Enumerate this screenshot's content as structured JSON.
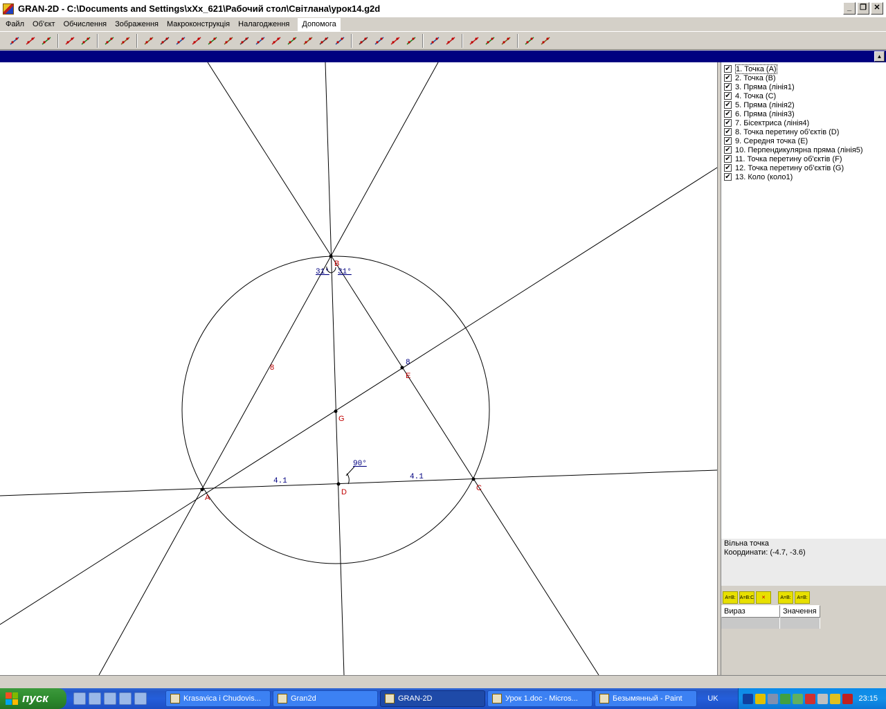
{
  "window": {
    "title": "GRAN-2D - C:\\Documents and Settings\\xXx_621\\Рабочий стол\\Світлана\\урок14.g2d",
    "buttons": {
      "minimize": "_",
      "maximize": "❐",
      "close": "✕"
    }
  },
  "menu": [
    "Файл",
    "Об'єкт",
    "Обчислення",
    "Зображення",
    "Макроконструкція",
    "Налагодження",
    "Допомога"
  ],
  "toolbar_groups": [
    [
      "new-file-icon",
      "open-folder-icon",
      "save-disk-icon"
    ],
    [
      "film-icon",
      "gears-icon"
    ],
    [
      "disabled-circle-icon",
      "scissors-icon"
    ],
    [
      "point-icon",
      "two-points-icon",
      "cross-lines-icon",
      "intersection-icon",
      "segment-icon",
      "parallel-icon",
      "perpendicular-icon",
      "angle-icon",
      "bisector-icon",
      "tangent-icon",
      "circle-icon",
      "arc-icon",
      "curve-icon"
    ],
    [
      "zoom-in-icon",
      "zoom-out-icon",
      "zoom-icon",
      "zoom-fit-icon"
    ],
    [
      "move-icon",
      "rotate-icon"
    ],
    [
      "calculator-icon",
      "measure-icon",
      "ruler-icon"
    ],
    [
      "macro-run-icon",
      "macro-edit-icon"
    ]
  ],
  "objects": [
    {
      "label": "1. Точка (A)",
      "checked": true,
      "selected": true
    },
    {
      "label": "2. Точка (B)",
      "checked": true
    },
    {
      "label": "3. Пряма (лінія1)",
      "checked": true
    },
    {
      "label": "4. Точка (C)",
      "checked": true
    },
    {
      "label": "5. Пряма (лінія2)",
      "checked": true
    },
    {
      "label": "6. Пряма (лінія3)",
      "checked": true
    },
    {
      "label": "7. Бісектриса (лінія4)",
      "checked": true
    },
    {
      "label": "8. Точка перетину об'єктів (D)",
      "checked": true
    },
    {
      "label": "9. Середня точка (E)",
      "checked": true
    },
    {
      "label": "10. Перпендикулярна пряма (лінія5)",
      "checked": true
    },
    {
      "label": "11. Точка перетину об'єктів (F)",
      "checked": true
    },
    {
      "label": "12. Точка перетину об'єктів (G)",
      "checked": true
    },
    {
      "label": "13. Коло (коло1)",
      "checked": true
    }
  ],
  "info": {
    "type": "Вільна точка",
    "coords": "Координати: (-4.7, -3.6)"
  },
  "expr_buttons": [
    "A=B:",
    "A=B:C",
    "✕",
    "A=B:",
    "A=B:"
  ],
  "expr_table": {
    "col1": "Вираз",
    "col2": "Значення"
  },
  "drawing": {
    "point_labels": {
      "A": "A",
      "B": "B",
      "C": "C",
      "D": "D",
      "E": "E",
      "G": "G"
    },
    "angle_left": "31°",
    "angle_right": "31°",
    "angle_right_deg": "°",
    "right_angle": "90°",
    "len_AD": "4.1",
    "len_DC": "4.1",
    "len_AB": "8",
    "len_BC": "8",
    "colors": {
      "label": "#c00000",
      "measure": "#000080",
      "line": "#000000"
    }
  },
  "taskbar": {
    "start": "пуск",
    "tasks": [
      {
        "label": "Krasavica i Chudovis...",
        "icon": "warning-app-icon"
      },
      {
        "label": "Gran2d",
        "icon": "folder-icon"
      },
      {
        "label": "GRAN-2D",
        "icon": "gran-app-icon",
        "active": true
      },
      {
        "label": "Урок 1.doc - Micros...",
        "icon": "word-icon"
      },
      {
        "label": "Безымянный - Paint",
        "icon": "paint-icon"
      }
    ],
    "lang": "UK",
    "clock": "23:15"
  }
}
